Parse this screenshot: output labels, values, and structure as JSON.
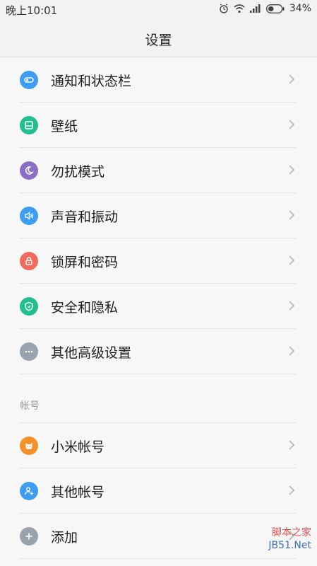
{
  "status_bar": {
    "time": "晚上10:01",
    "battery": "34%",
    "icons": [
      "alarm-icon",
      "wifi-icon",
      "signal-icon",
      "battery-icon"
    ]
  },
  "header": {
    "title": "设置"
  },
  "settings": [
    {
      "label": "通知和状态栏",
      "icon": "notification-toggle-icon",
      "color": "#3d9df2"
    },
    {
      "label": "壁纸",
      "icon": "wallpaper-icon",
      "color": "#1fbf8f"
    },
    {
      "label": "勿扰模式",
      "icon": "moon-icon",
      "color": "#8b6fc4"
    },
    {
      "label": "声音和振动",
      "icon": "speaker-icon",
      "color": "#3d9df2"
    },
    {
      "label": "锁屏和密码",
      "icon": "lock-icon",
      "color": "#f26a5b"
    },
    {
      "label": "安全和隐私",
      "icon": "shield-icon",
      "color": "#1fbf8f"
    },
    {
      "label": "其他高级设置",
      "icon": "more-icon",
      "color": "#9aa3ad"
    }
  ],
  "account_section": {
    "header": "帐号",
    "items": [
      {
        "label": "小米帐号",
        "icon": "mi-account-icon",
        "color": "#f5902a"
      },
      {
        "label": "其他帐号",
        "icon": "user-icon",
        "color": "#3d9df2"
      },
      {
        "label": "添加",
        "icon": "plus-icon",
        "color": "#9aa3ad"
      }
    ]
  },
  "watermark": {
    "line1": "脚本之家",
    "line2": "JB51.Net"
  }
}
